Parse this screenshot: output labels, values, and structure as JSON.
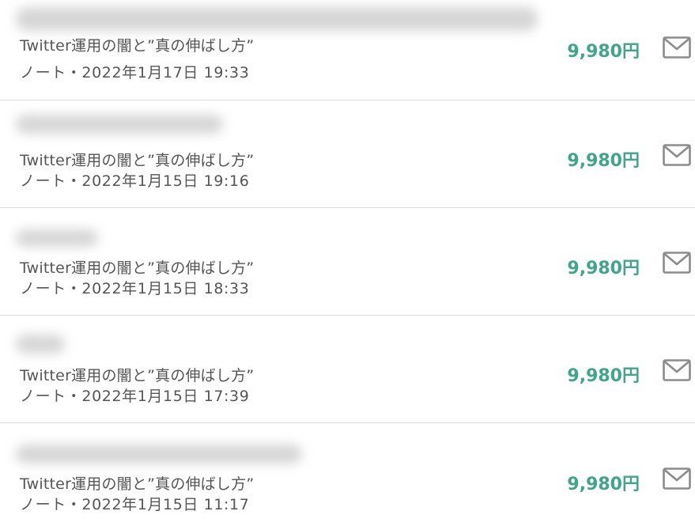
{
  "colors": {
    "price": "#41a58a",
    "text": "#555555",
    "divider": "#dcdcdc",
    "icon": "#8c8c8c"
  },
  "icons": {
    "message": "mail-icon"
  },
  "sales": [
    {
      "title": "Twitter運用の闇と”真の伸ばし方”",
      "meta": "ノート・2022年1月17日 19:33",
      "price": "9,980円"
    },
    {
      "title": "Twitter運用の闇と”真の伸ばし方”",
      "meta": "ノート・2022年1月15日 19:16",
      "price": "9,980円"
    },
    {
      "title": "Twitter運用の闇と”真の伸ばし方”",
      "meta": "ノート・2022年1月15日 18:33",
      "price": "9,980円"
    },
    {
      "title": "Twitter運用の闇と”真の伸ばし方”",
      "meta": "ノート・2022年1月15日 17:39",
      "price": "9,980円"
    },
    {
      "title": "Twitter運用の闇と”真の伸ばし方”",
      "meta": "ノート・2022年1月15日 11:17",
      "price": "9,980円"
    }
  ]
}
